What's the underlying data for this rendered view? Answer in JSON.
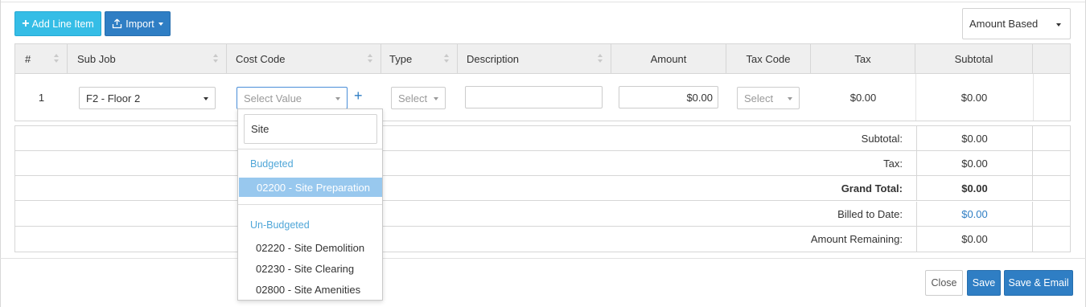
{
  "toolbar": {
    "add_line_item": "Add Line Item",
    "import": "Import",
    "amount_mode": "Amount Based"
  },
  "columns": [
    "#",
    "Sub Job",
    "Cost Code",
    "Type",
    "Description",
    "Amount",
    "Tax Code",
    "Tax",
    "Subtotal"
  ],
  "row": {
    "number": "1",
    "sub_job": "F2 - Floor 2",
    "cost_code_placeholder": "Select Value",
    "type_placeholder": "Select",
    "description": "",
    "amount": "$0.00",
    "tax_code_placeholder": "Select",
    "tax": "$0.00",
    "subtotal": "$0.00"
  },
  "totals": [
    {
      "label": "Subtotal:",
      "value": "$0.00"
    },
    {
      "label": "Tax:",
      "value": "$0.00"
    },
    {
      "label": "Grand Total:",
      "value": "$0.00"
    },
    {
      "label": "Billed to Date:",
      "value": "$0.00"
    },
    {
      "label": "Amount Remaining:",
      "value": "$0.00"
    }
  ],
  "dropdown": {
    "search_value": "Site",
    "group_budgeted": "Budgeted",
    "group_unbudgeted": "Un-Budgeted",
    "budgeted_items": [
      "02200 - Site Preparation"
    ],
    "unbudgeted_items": [
      "02220 - Site Demolition",
      "02230 - Site Clearing",
      "02800 - Site Amenities"
    ]
  },
  "footer": {
    "close": "Close",
    "save": "Save",
    "save_email": "Save & Email"
  },
  "colors": {
    "primary": "#2f7ec4",
    "accent": "#35bde6",
    "link": "#2f7ec4",
    "highlight": "#98c8ee"
  }
}
